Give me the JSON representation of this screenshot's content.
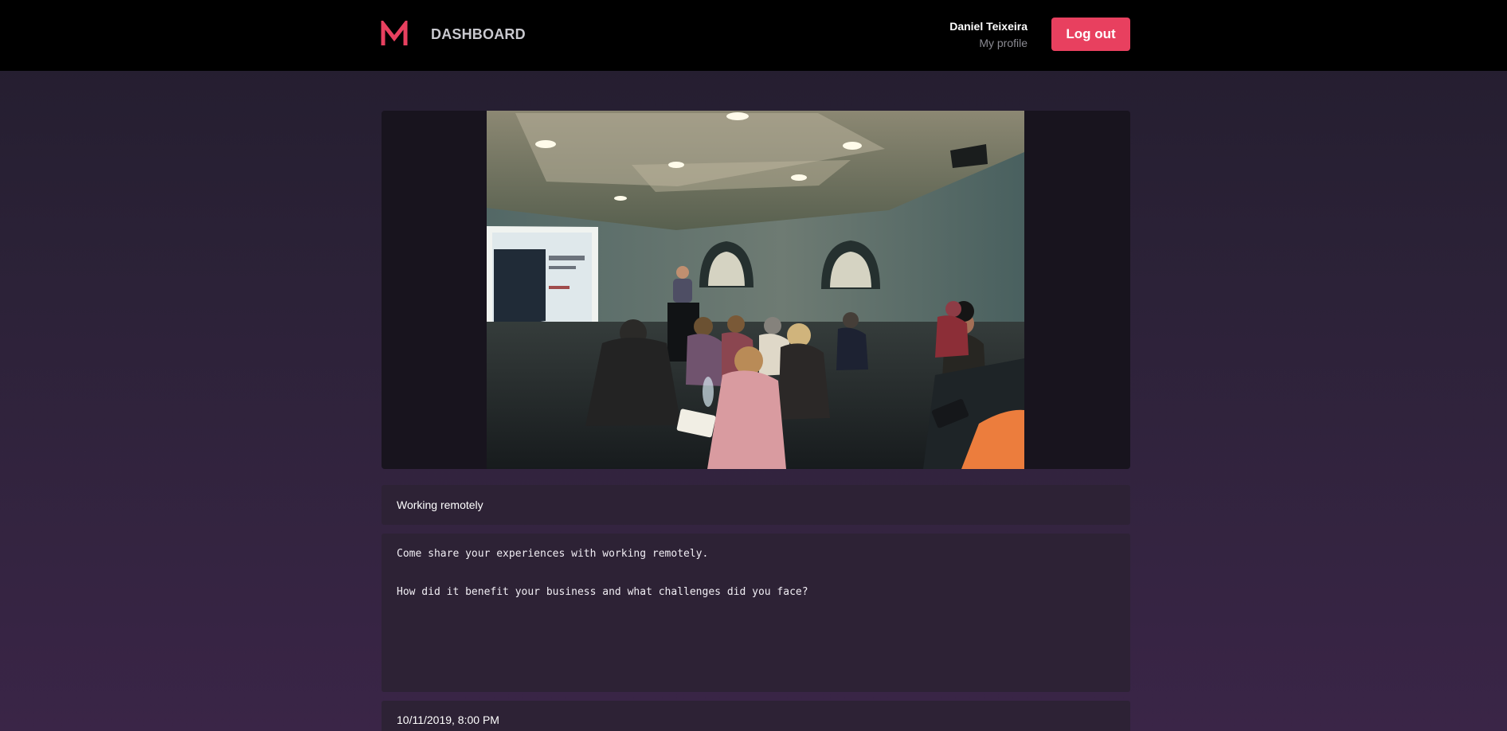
{
  "header": {
    "title": "DASHBOARD",
    "logo_icon": "m-logo-icon",
    "user_name": "Daniel Teixeira",
    "profile_link": "My profile",
    "logout_label": "Log out"
  },
  "event": {
    "image_icon": "presentation-photo",
    "title": "Working remotely",
    "description_line_1": "Come share your experiences with working remotely.",
    "description_line_2": "How did it benefit your business and what challenges did you face?",
    "date": "10/11/2019, 8:00 PM"
  },
  "colors": {
    "accent": "#e8405f",
    "header_bg": "#000000",
    "card_bg": "#2d2235",
    "panel_bg": "#18141e"
  }
}
